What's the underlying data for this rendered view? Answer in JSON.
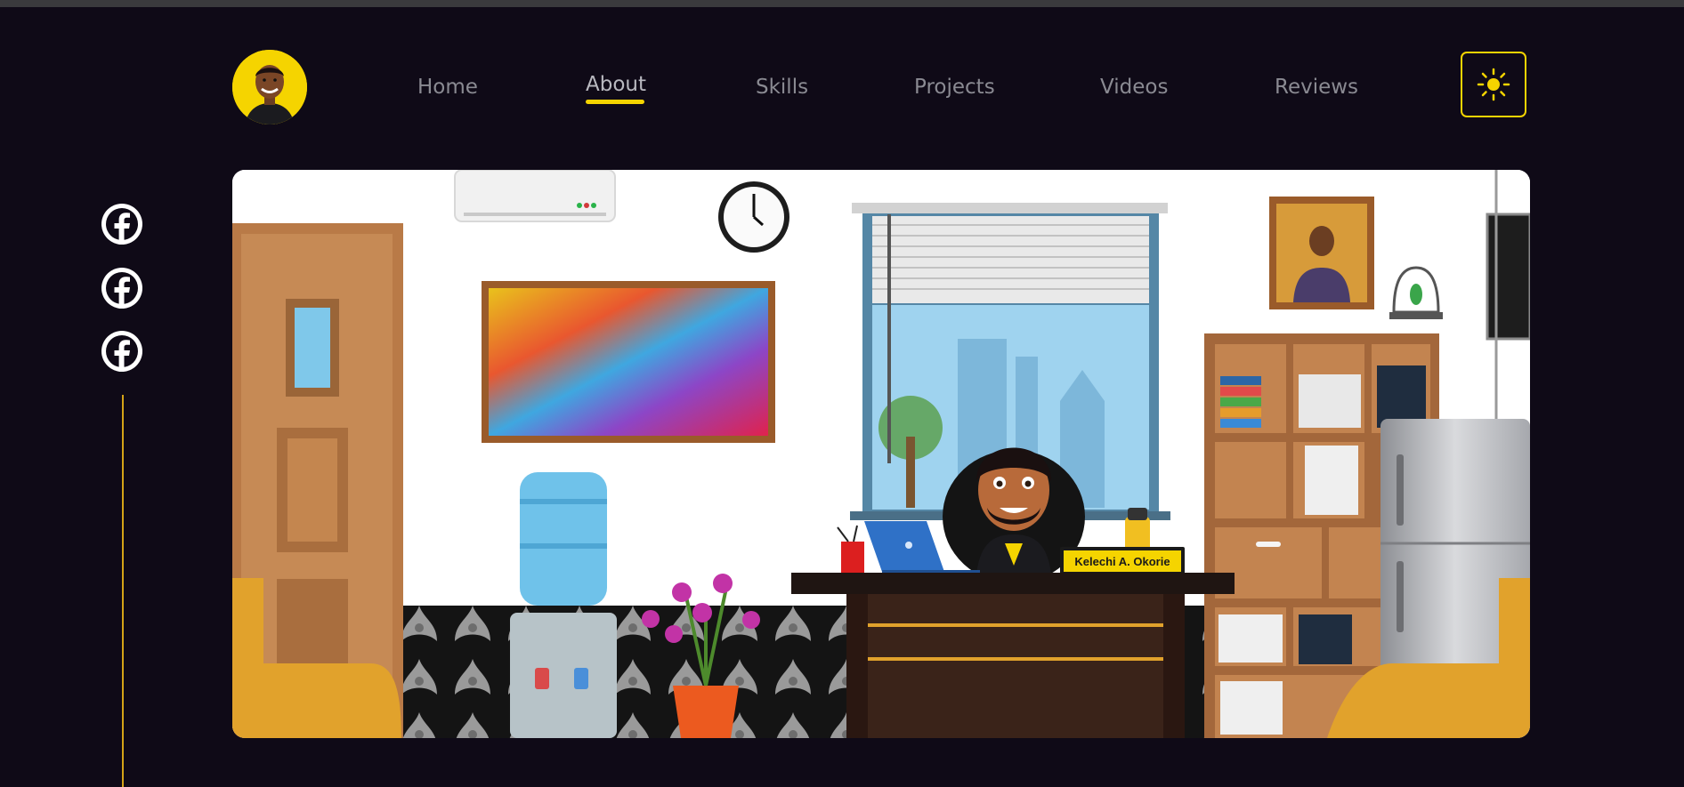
{
  "nav": {
    "links": [
      {
        "label": "Home",
        "active": false
      },
      {
        "label": "About",
        "active": true
      },
      {
        "label": "Skills",
        "active": false
      },
      {
        "label": "Projects",
        "active": false
      },
      {
        "label": "Videos",
        "active": false
      },
      {
        "label": "Reviews",
        "active": false
      }
    ],
    "accent_color": "#f5d400",
    "theme_toggle_icon": "sun-icon"
  },
  "social": {
    "icons": [
      "facebook-icon",
      "facebook-icon",
      "facebook-icon"
    ]
  },
  "hero": {
    "nameplate": "Kelechi A. Okorie"
  },
  "colors": {
    "background": "#0f0a17",
    "accent": "#f5d400",
    "nav_text": "#8a8a92"
  }
}
